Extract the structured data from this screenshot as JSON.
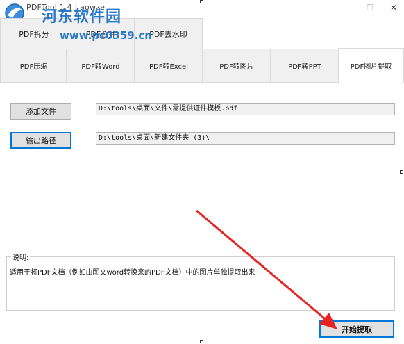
{
  "window": {
    "title": "PDFTool 1.4  |  aowze",
    "minimize_glyph": "—",
    "maximize_glyph": "☐",
    "close_glyph": "✕"
  },
  "watermark": {
    "site_name": "河东软件园",
    "url": "www.pc0359.cn"
  },
  "tabs_row1": [
    {
      "label": "PDF拆分"
    },
    {
      "label": "PDF合并"
    },
    {
      "label": "PDF去水印"
    }
  ],
  "tabs_row2": [
    {
      "label": "PDF压缩"
    },
    {
      "label": "PDF转Word"
    },
    {
      "label": "PDF转Excel"
    },
    {
      "label": "PDF转图片"
    },
    {
      "label": "PDF转PPT"
    },
    {
      "label": "PDF图片提取",
      "active": true
    }
  ],
  "form": {
    "add_file_label": "添加文件",
    "add_file_path": "D:\\tools\\桌面\\文件\\需提供证件模板.pdf",
    "output_label": "输出路径",
    "output_path": "D:\\tools\\桌面\\新建文件夹 (3)\\"
  },
  "description": {
    "legend": "说明:",
    "text": "适用于将PDF文档（例如由图文word转换来的PDF文档）中的图片单独提取出来"
  },
  "start_button": {
    "label": "开始提取"
  },
  "colors": {
    "accent": "#0078d7",
    "annotation_arrow": "#e8231f",
    "watermark": "#2a78c8"
  }
}
